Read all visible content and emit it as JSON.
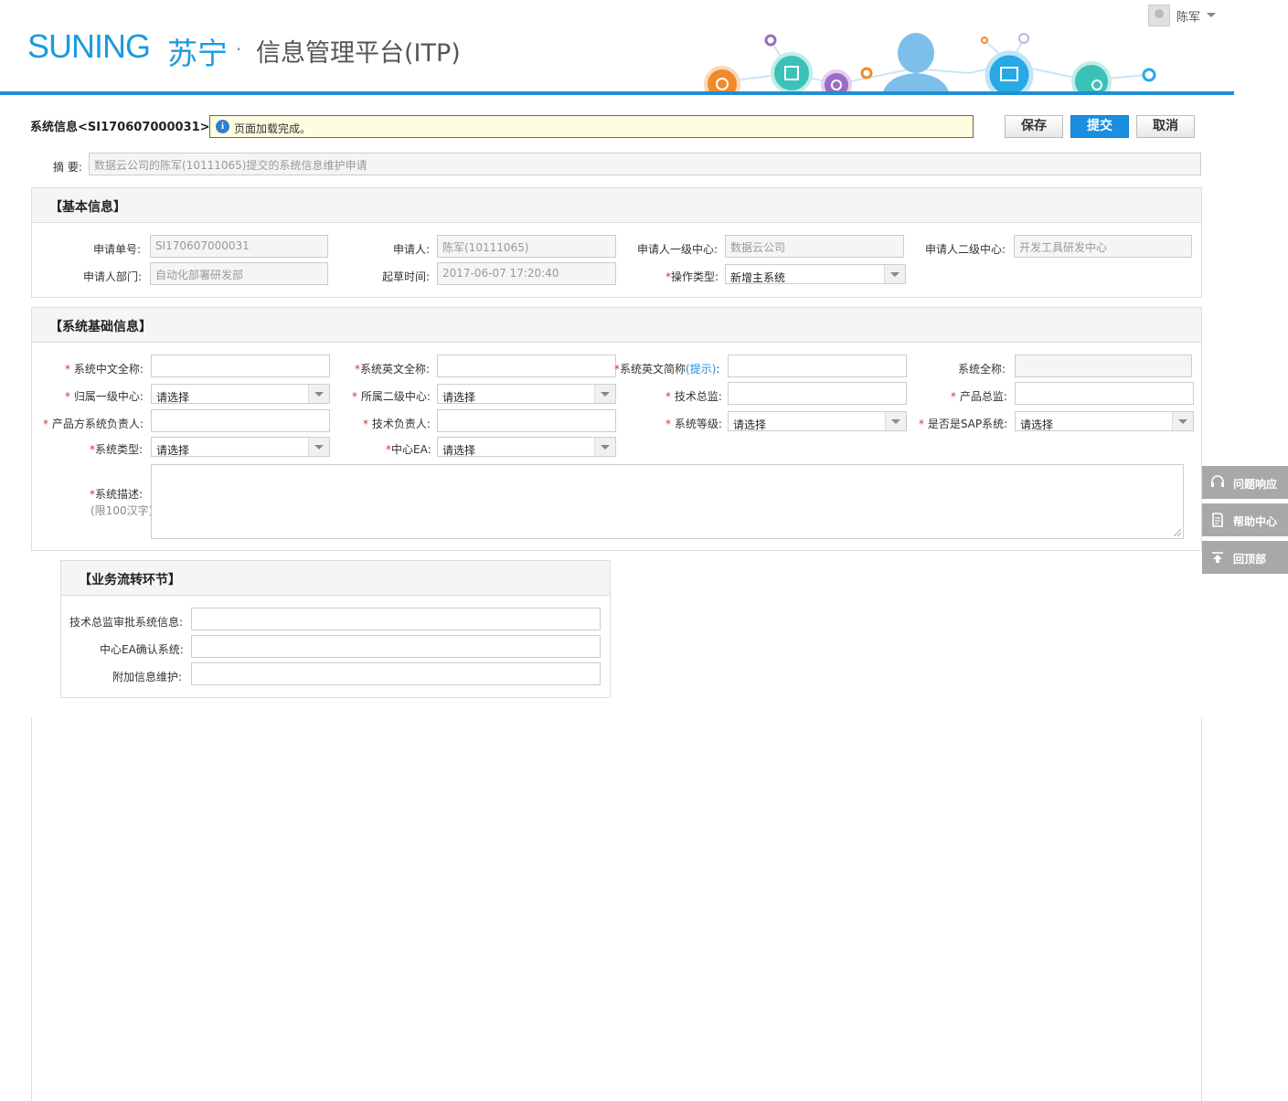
{
  "header": {
    "brand_en": "SUNING",
    "brand_cn": "苏宁",
    "brand_dot": "·",
    "product": "信息管理平台(ITP)",
    "user_name": "陈军",
    "accent": "#1a9ae0"
  },
  "title": "系统信息<SI170607000031>",
  "message": {
    "icon": "info-icon",
    "text": "页面加载完成。"
  },
  "toolbar": {
    "save": "保存",
    "submit": "提交",
    "cancel": "取消"
  },
  "summary": {
    "label": "摘 要:",
    "value": "数据云公司的陈军(10111065)提交的系统信息维护申请"
  },
  "basic_info": {
    "title": "【基本信息】",
    "fields": {
      "request_no": {
        "label": "申请单号:",
        "value": "SI170607000031"
      },
      "applicant": {
        "label": "申请人:",
        "value": "陈军(10111065)"
      },
      "center1": {
        "label": "申请人一级中心:",
        "value": "数据云公司"
      },
      "center2": {
        "label": "申请人二级中心:",
        "value": "开发工具研发中心"
      },
      "dept": {
        "label": "申请人部门:",
        "value": "自动化部署研发部"
      },
      "draft_time": {
        "label": "起草时间:",
        "value": "2017-06-07 17:20:40"
      },
      "op_type": {
        "label": "操作类型:",
        "value": "新增主系统"
      }
    }
  },
  "system_info": {
    "title": "【系统基础信息】",
    "fields": {
      "cn_name": {
        "label": "系统中文全称:"
      },
      "en_name": {
        "label": "系统英文全称:"
      },
      "en_abbr": {
        "label": "系统英文简称",
        "hint": "(提示)",
        "colon": ":"
      },
      "full_name": {
        "label": "系统全称:"
      },
      "center1": {
        "label": "归属一级中心:",
        "value": "请选择"
      },
      "center2": {
        "label": "所属二级中心:",
        "value": "请选择"
      },
      "tech_director": {
        "label": "技术总监:"
      },
      "product_director": {
        "label": "产品总监:"
      },
      "product_owner": {
        "label": "产品方系统负责人:"
      },
      "tech_owner": {
        "label": "技术负责人:"
      },
      "level": {
        "label": "系统等级:",
        "value": "请选择"
      },
      "is_sap": {
        "label": "是否是SAP系统:",
        "value": "请选择"
      },
      "sys_type": {
        "label": "系统类型:",
        "value": "请选择"
      },
      "center_ea": {
        "label": "中心EA:",
        "value": "请选择"
      },
      "desc": {
        "label": "系统描述:",
        "sub": "(限100汉字)"
      }
    }
  },
  "workflow": {
    "title": "【业务流转环节】",
    "steps": [
      {
        "label": "技术总监审批系统信息:"
      },
      {
        "label": "中心EA确认系统:"
      },
      {
        "label": "附加信息维护:"
      }
    ]
  },
  "side": {
    "feedback": "问题响应",
    "help": "帮助中心",
    "top": "回顶部"
  }
}
